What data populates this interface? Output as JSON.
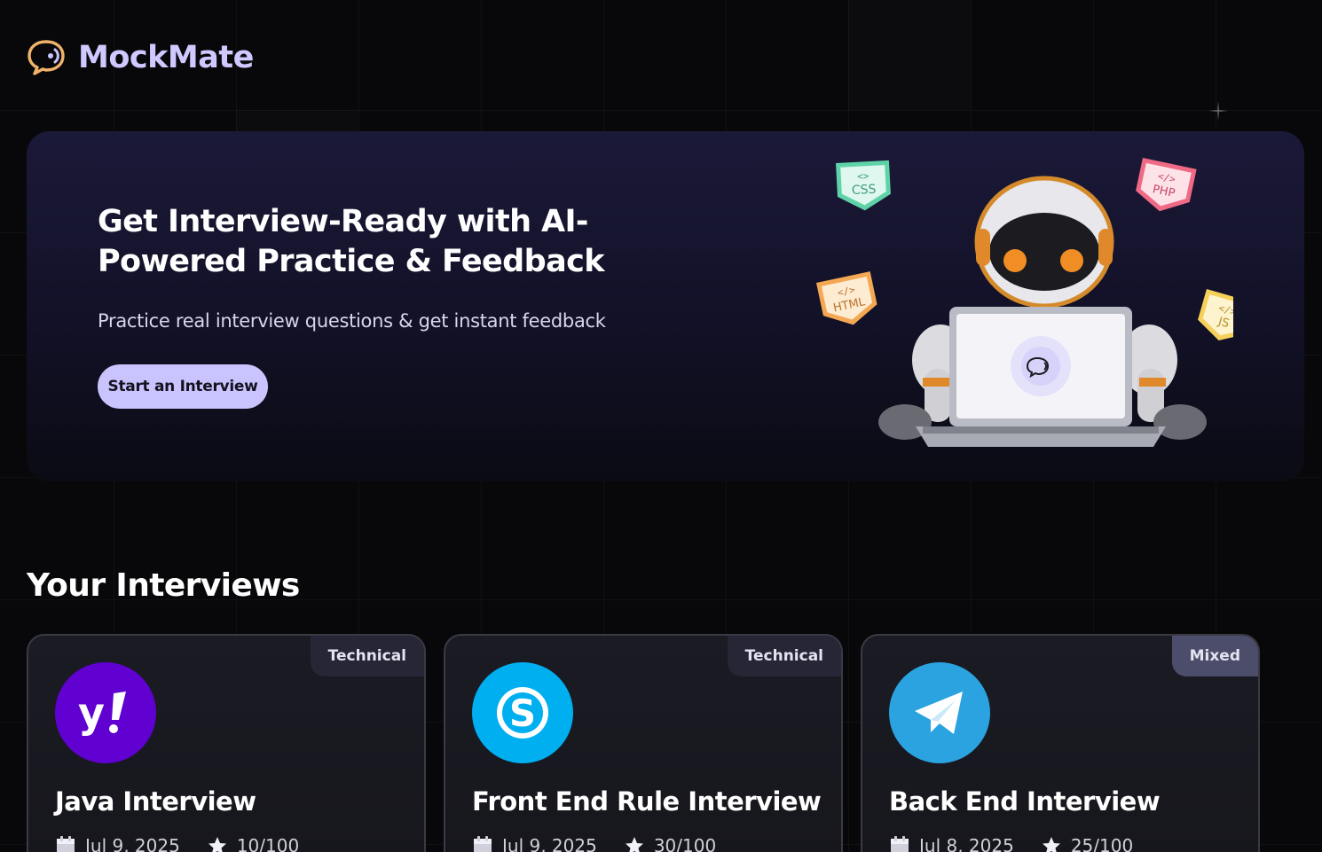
{
  "app": {
    "brand": "MockMate",
    "accent": "#cac4fe",
    "background": "#08080a"
  },
  "hero": {
    "title": "Get Interview-Ready with AI-Powered Practice & Feedback",
    "subtitle": "Practice real interview questions & get instant feedback",
    "cta_label": "Start an Interview",
    "tech_tags": [
      "CSS",
      "PHP",
      "HTML",
      "JS"
    ]
  },
  "interviews": {
    "heading": "Your Interviews",
    "cards": [
      {
        "title": "Java Interview",
        "type": "Technical",
        "date": "Jul 9, 2025",
        "score": "10/100",
        "logo": "yahoo-icon",
        "logo_color": "#6001d2"
      },
      {
        "title": "Front End Rule Interview",
        "type": "Technical",
        "date": "Jul 9, 2025",
        "score": "30/100",
        "logo": "skype-icon",
        "logo_color": "#00aff0"
      },
      {
        "title": "Back End Interview",
        "type": "Mixed",
        "date": "Jul 8, 2025",
        "score": "25/100",
        "logo": "telegram-icon",
        "logo_color": "#2aa3e0"
      }
    ]
  }
}
